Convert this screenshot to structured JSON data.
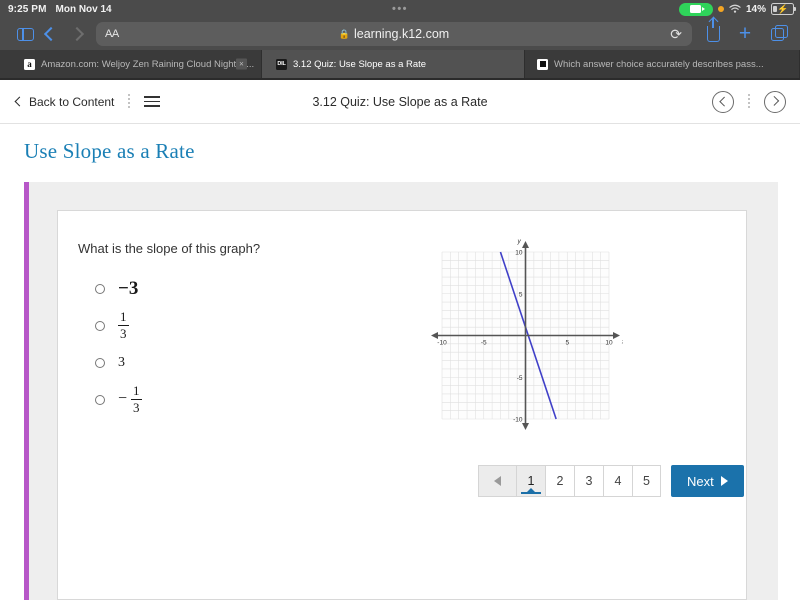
{
  "status_bar": {
    "time": "9:25 PM",
    "date": "Mon Nov 14",
    "battery_percent": "14%",
    "recording_icon": "camera-recording-icon",
    "privacy_dot_icon": "orange-privacy-dot-icon",
    "wifi_icon": "wifi-icon",
    "battery_icon": "battery-charging-icon",
    "dots_icon": "multitasking-dots-icon"
  },
  "browser_toolbar": {
    "sidebar_icon": "sidebar-icon",
    "back_icon": "chevron-left-icon",
    "forward_icon": "chevron-right-icon",
    "text_size_label": "AA",
    "lock_icon": "lock-icon",
    "url": "learning.k12.com",
    "reload_icon": "reload-icon",
    "share_icon": "share-icon",
    "new_tab_icon": "plus-icon",
    "tabs_icon": "tabs-overview-icon"
  },
  "tabs": [
    {
      "title": "Amazon.com: Weljoy Zen Raining Cloud Night Li...",
      "favicon": "amazon-favicon",
      "active": false,
      "close_label": "×"
    },
    {
      "title": "3.12 Quiz: Use Slope as a Rate",
      "favicon": "k12-favicon",
      "active": true
    },
    {
      "title": "Which answer choice accurately describes pass...",
      "favicon": "powerschool-favicon",
      "active": false
    }
  ],
  "page_header": {
    "back_label": "Back to Content",
    "back_icon": "chevron-left-icon",
    "menu_icon": "hamburger-menu-icon",
    "title": "3.12 Quiz: Use Slope as a Rate",
    "prev_icon": "circle-chevron-left-icon",
    "next_icon": "circle-chevron-right-icon",
    "more_icon": "vertical-dots-icon"
  },
  "lesson": {
    "title": "Use Slope as a Rate",
    "title_color": "#1a7fb5",
    "accent_color": "#b757c8"
  },
  "question": {
    "prompt": "What is the slope of this graph?",
    "choices": [
      {
        "id": "a",
        "display": "−3",
        "type": "integer",
        "value": "-3",
        "selected": false
      },
      {
        "id": "b",
        "display": "1/3",
        "type": "fraction",
        "numerator": "1",
        "denominator": "3",
        "negative": false,
        "selected": false
      },
      {
        "id": "c",
        "display": "3",
        "type": "integer",
        "value": "3",
        "selected": false
      },
      {
        "id": "d",
        "display": "−1/3",
        "type": "fraction",
        "numerator": "1",
        "denominator": "3",
        "negative": true,
        "selected": false
      }
    ]
  },
  "chart_data": {
    "type": "line",
    "title": "",
    "xlabel": "x",
    "ylabel": "y",
    "xlim": [
      -10,
      10
    ],
    "ylim": [
      -10,
      10
    ],
    "xticks": [
      -10,
      -5,
      5,
      10
    ],
    "yticks": [
      10,
      5,
      -5,
      -10
    ],
    "xtick_labels": [
      "-10",
      "-5",
      "5",
      "10"
    ],
    "ytick_labels": [
      "10",
      "5",
      "-5",
      "-10"
    ],
    "grid": true,
    "grid_minor_step": 1,
    "grid_color": "#e0e0e0",
    "axis_color": "#555555",
    "legend": "none",
    "series": [
      {
        "name": "line",
        "color": "#4040c8",
        "slope": -3,
        "intercept": 1,
        "points": [
          [
            -3,
            10
          ],
          [
            0,
            1
          ],
          [
            3.67,
            -10
          ]
        ],
        "equation": "y = -3x + 1"
      }
    ]
  },
  "pagination": {
    "prev_icon": "triangle-left-icon",
    "pages": [
      "1",
      "2",
      "3",
      "4",
      "5"
    ],
    "active_page": "1",
    "next_label": "Next",
    "next_icon": "triangle-right-icon",
    "next_color": "#1b72ab"
  }
}
